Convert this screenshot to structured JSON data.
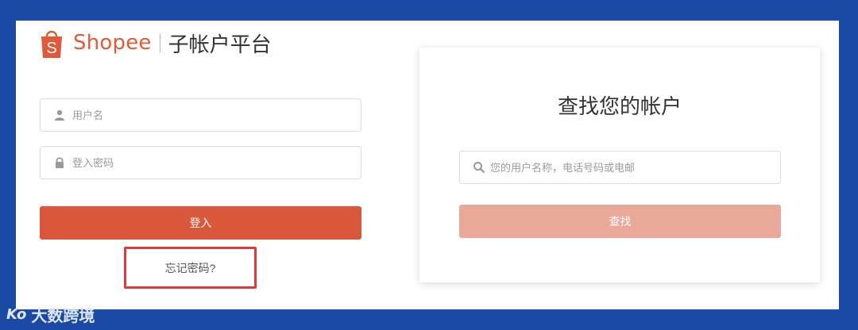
{
  "header": {
    "brand": "Shopee",
    "platform_title": "子帐户平台"
  },
  "login": {
    "username_placeholder": "用户名",
    "password_placeholder": "登入密码",
    "login_label": "登入",
    "forgot_label": "忘记密码?"
  },
  "find_account": {
    "title": "查找您的帐户",
    "search_placeholder": "您的用户名称，电话号码或电邮",
    "find_label": "查找"
  },
  "watermark": {
    "mark": "Ko",
    "text": "大数跨境"
  },
  "colors": {
    "brand": "#e05a3a",
    "login_button": "#d9573a",
    "find_button": "#e9a898",
    "highlight_border": "#e23a3a",
    "frame": "#1a4aa6"
  },
  "icons": {
    "user": "user-icon",
    "lock": "lock-icon",
    "search": "search-icon",
    "logo": "shopee-bag-logo"
  }
}
